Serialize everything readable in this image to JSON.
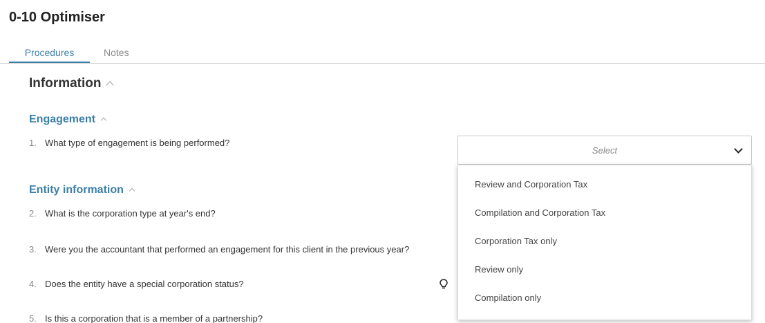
{
  "page": {
    "title": "0-10 Optimiser"
  },
  "tabs": [
    {
      "label": "Procedures",
      "active": true
    },
    {
      "label": "Notes",
      "active": false
    }
  ],
  "section": {
    "title": "Information"
  },
  "subsections": [
    {
      "title": "Engagement"
    },
    {
      "title": "Entity information"
    }
  ],
  "questions": [
    {
      "num": "1.",
      "text": "What type of engagement is being performed?"
    },
    {
      "num": "2.",
      "text": "What is the corporation type at year's end?"
    },
    {
      "num": "3.",
      "text": "Were you the accountant that performed an engagement for this client in the previous year?"
    },
    {
      "num": "4.",
      "text": "Does the entity have a special corporation status?"
    },
    {
      "num": "5.",
      "text": "Is this a corporation that is a member of a partnership?"
    }
  ],
  "select": {
    "placeholder": "Select",
    "options": [
      "Review and Corporation Tax",
      "Compilation and Corporation Tax",
      "Corporation Tax only",
      "Review only",
      "Compilation only"
    ]
  },
  "colors": {
    "accent": "#3b7fa6",
    "text": "#333333",
    "muted": "#888888"
  }
}
